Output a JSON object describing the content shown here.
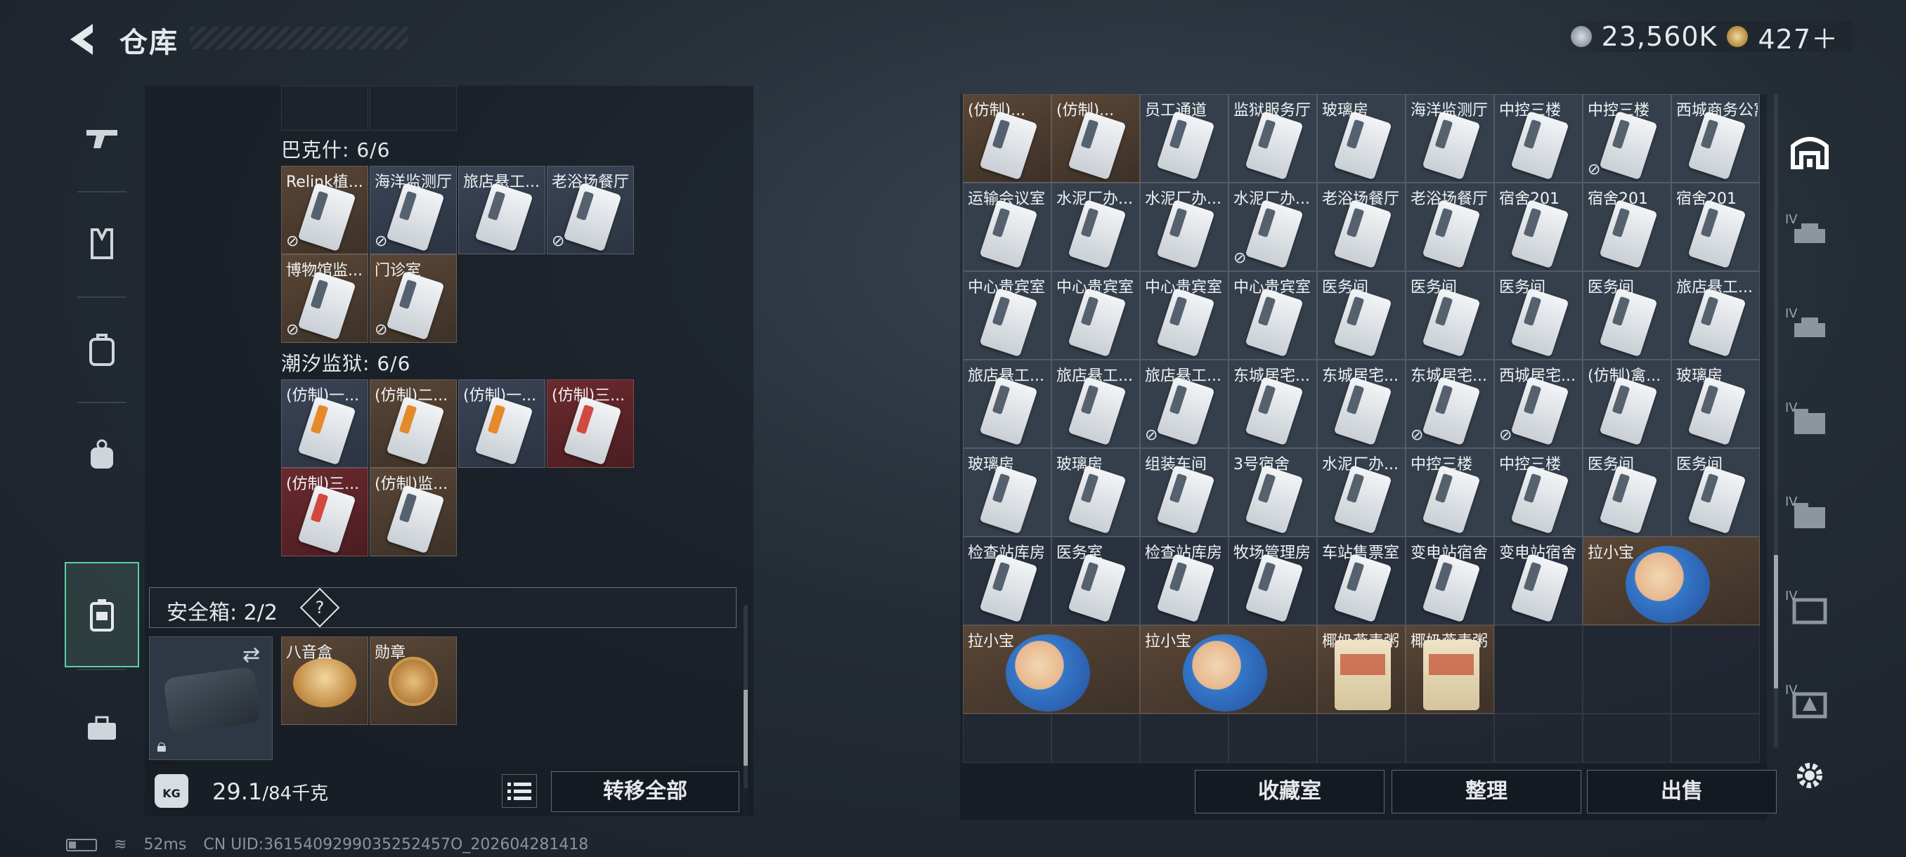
{
  "header": {
    "title": "仓库",
    "currency": [
      {
        "icon": "silver-coin-icon",
        "value": "23,560K"
      },
      {
        "icon": "gold-coin-icon",
        "value": "427＋"
      }
    ]
  },
  "left_nav": [
    "weapon-tab",
    "armor-tab",
    "backpack-tab",
    "bag-tab",
    "safe-box-tab",
    "toolbox-tab"
  ],
  "left_panel": {
    "sections": [
      {
        "title": "巴克什: 6/6",
        "items": [
          {
            "label": "Relink植...",
            "style": "brown",
            "card": "gray",
            "nolink": true
          },
          {
            "label": "海洋监测厅",
            "style": "brown",
            "card": "gray",
            "nolink": true
          },
          {
            "label": "旅店悬工...",
            "style": "blue",
            "card": "gray",
            "nolink": false
          },
          {
            "label": "老浴场餐厅",
            "style": "blue",
            "card": "gray",
            "nolink": true
          },
          {
            "label": "博物馆监...",
            "style": "brown",
            "card": "gray",
            "nolink": true
          },
          {
            "label": "门诊室",
            "style": "brown",
            "card": "gray",
            "nolink": true
          }
        ]
      },
      {
        "title": "潮汐监狱: 6/6",
        "items": [
          {
            "label": "(仿制)一...",
            "style": "blue",
            "card": "orange",
            "nolink": false
          },
          {
            "label": "(仿制)二...",
            "style": "brown",
            "card": "orange",
            "nolink": false
          },
          {
            "label": "(仿制)一...",
            "style": "blue",
            "card": "orange",
            "nolink": false
          },
          {
            "label": "(仿制)三...",
            "style": "red",
            "card": "red",
            "nolink": false
          },
          {
            "label": "(仿制)三...",
            "style": "red",
            "card": "red",
            "nolink": false
          },
          {
            "label": "(仿制)监...",
            "style": "brown",
            "card": "gray",
            "nolink": false
          }
        ]
      }
    ],
    "safebox": {
      "label": "安全箱: 2/2",
      "help": "?",
      "items": [
        {
          "label": "八音盒",
          "kind": "music-box"
        },
        {
          "label": "勋章",
          "kind": "medal"
        }
      ]
    },
    "weight": {
      "current": "29.1",
      "max": "/84千克",
      "icon_text": "KG"
    },
    "transfer_label": "转移全部"
  },
  "right_panel": {
    "rows": [
      [
        {
          "label": "(仿制)...",
          "style": "brown"
        },
        {
          "label": "(仿制)...",
          "style": "brown"
        },
        {
          "label": "员工通道",
          "style": "blue"
        },
        {
          "label": "监狱服务厅",
          "style": "blue"
        },
        {
          "label": "玻璃房",
          "style": "blue"
        },
        {
          "label": "海洋监测厅",
          "style": "blue"
        },
        {
          "label": "中控三楼",
          "style": "blue"
        },
        {
          "label": "中控三楼",
          "style": "blue",
          "nolink": true
        },
        {
          "label": "西城商务公寓",
          "style": "blue"
        }
      ],
      [
        {
          "label": "运输会议室",
          "style": "blue"
        },
        {
          "label": "水泥厂办...",
          "style": "blue"
        },
        {
          "label": "水泥厂办...",
          "style": "blue"
        },
        {
          "label": "水泥厂办...",
          "style": "blue",
          "nolink": true
        },
        {
          "label": "老浴场餐厅",
          "style": "blue"
        },
        {
          "label": "老浴场餐厅",
          "style": "blue"
        },
        {
          "label": "宿舍201",
          "style": "blue"
        },
        {
          "label": "宿舍201",
          "style": "blue"
        },
        {
          "label": "宿舍201",
          "style": "blue"
        }
      ],
      [
        {
          "label": "中心贵宾室",
          "style": "blue"
        },
        {
          "label": "中心贵宾室",
          "style": "blue"
        },
        {
          "label": "中心贵宾室",
          "style": "blue"
        },
        {
          "label": "中心贵宾室",
          "style": "blue"
        },
        {
          "label": "医务间",
          "style": "blue"
        },
        {
          "label": "医务间",
          "style": "blue"
        },
        {
          "label": "医务间",
          "style": "blue"
        },
        {
          "label": "医务间",
          "style": "blue"
        },
        {
          "label": "旅店悬工...",
          "style": "blue"
        }
      ],
      [
        {
          "label": "旅店悬工...",
          "style": "blue"
        },
        {
          "label": "旅店悬工...",
          "style": "blue"
        },
        {
          "label": "旅店悬工...",
          "style": "blue",
          "nolink": true
        },
        {
          "label": "东城居宅...",
          "style": "blue"
        },
        {
          "label": "东城居宅...",
          "style": "blue"
        },
        {
          "label": "东城居宅...",
          "style": "blue",
          "nolink": true
        },
        {
          "label": "西城居宅...",
          "style": "blue",
          "nolink": true
        },
        {
          "label": "(仿制)禽...",
          "style": "blue"
        },
        {
          "label": "玻璃房",
          "style": "blue"
        }
      ],
      [
        {
          "label": "玻璃房",
          "style": "blue"
        },
        {
          "label": "玻璃房",
          "style": "blue"
        },
        {
          "label": "组装车间",
          "style": "blue"
        },
        {
          "label": "3号宿舍",
          "style": "blue"
        },
        {
          "label": "水泥厂办...",
          "style": "blue"
        },
        {
          "label": "中控三楼",
          "style": "blue"
        },
        {
          "label": "中控三楼",
          "style": "blue"
        },
        {
          "label": "医务间",
          "style": "blue"
        },
        {
          "label": "医务间",
          "style": "blue"
        }
      ],
      [
        {
          "label": "检查站库房",
          "style": "dark"
        },
        {
          "label": "医务室",
          "style": "dark"
        },
        {
          "label": "检查站库房",
          "style": "dark"
        },
        {
          "label": "牧场管理房",
          "style": "dark"
        },
        {
          "label": "车站售票室",
          "style": "dark"
        },
        {
          "label": "变电站宿舍",
          "style": "dark"
        },
        {
          "label": "变电站宿舍",
          "style": "dark"
        }
      ]
    ],
    "doll_items": [
      {
        "label": "拉小宝"
      },
      {
        "label": "拉小宝"
      },
      {
        "label": "拉小宝"
      }
    ],
    "food_items": [
      {
        "label": "椰奶燕麦粥"
      },
      {
        "label": "椰奶燕麦粥"
      }
    ],
    "buttons": {
      "collection": "收藏室",
      "sort": "整理",
      "sell": "出售"
    }
  },
  "right_nav_tags": [
    "IV",
    "IV",
    "IV",
    "IV",
    "IV",
    "IV"
  ],
  "status": {
    "ping": "52ms",
    "uid": "CN UID:3615409299035252457O_202604281418"
  }
}
